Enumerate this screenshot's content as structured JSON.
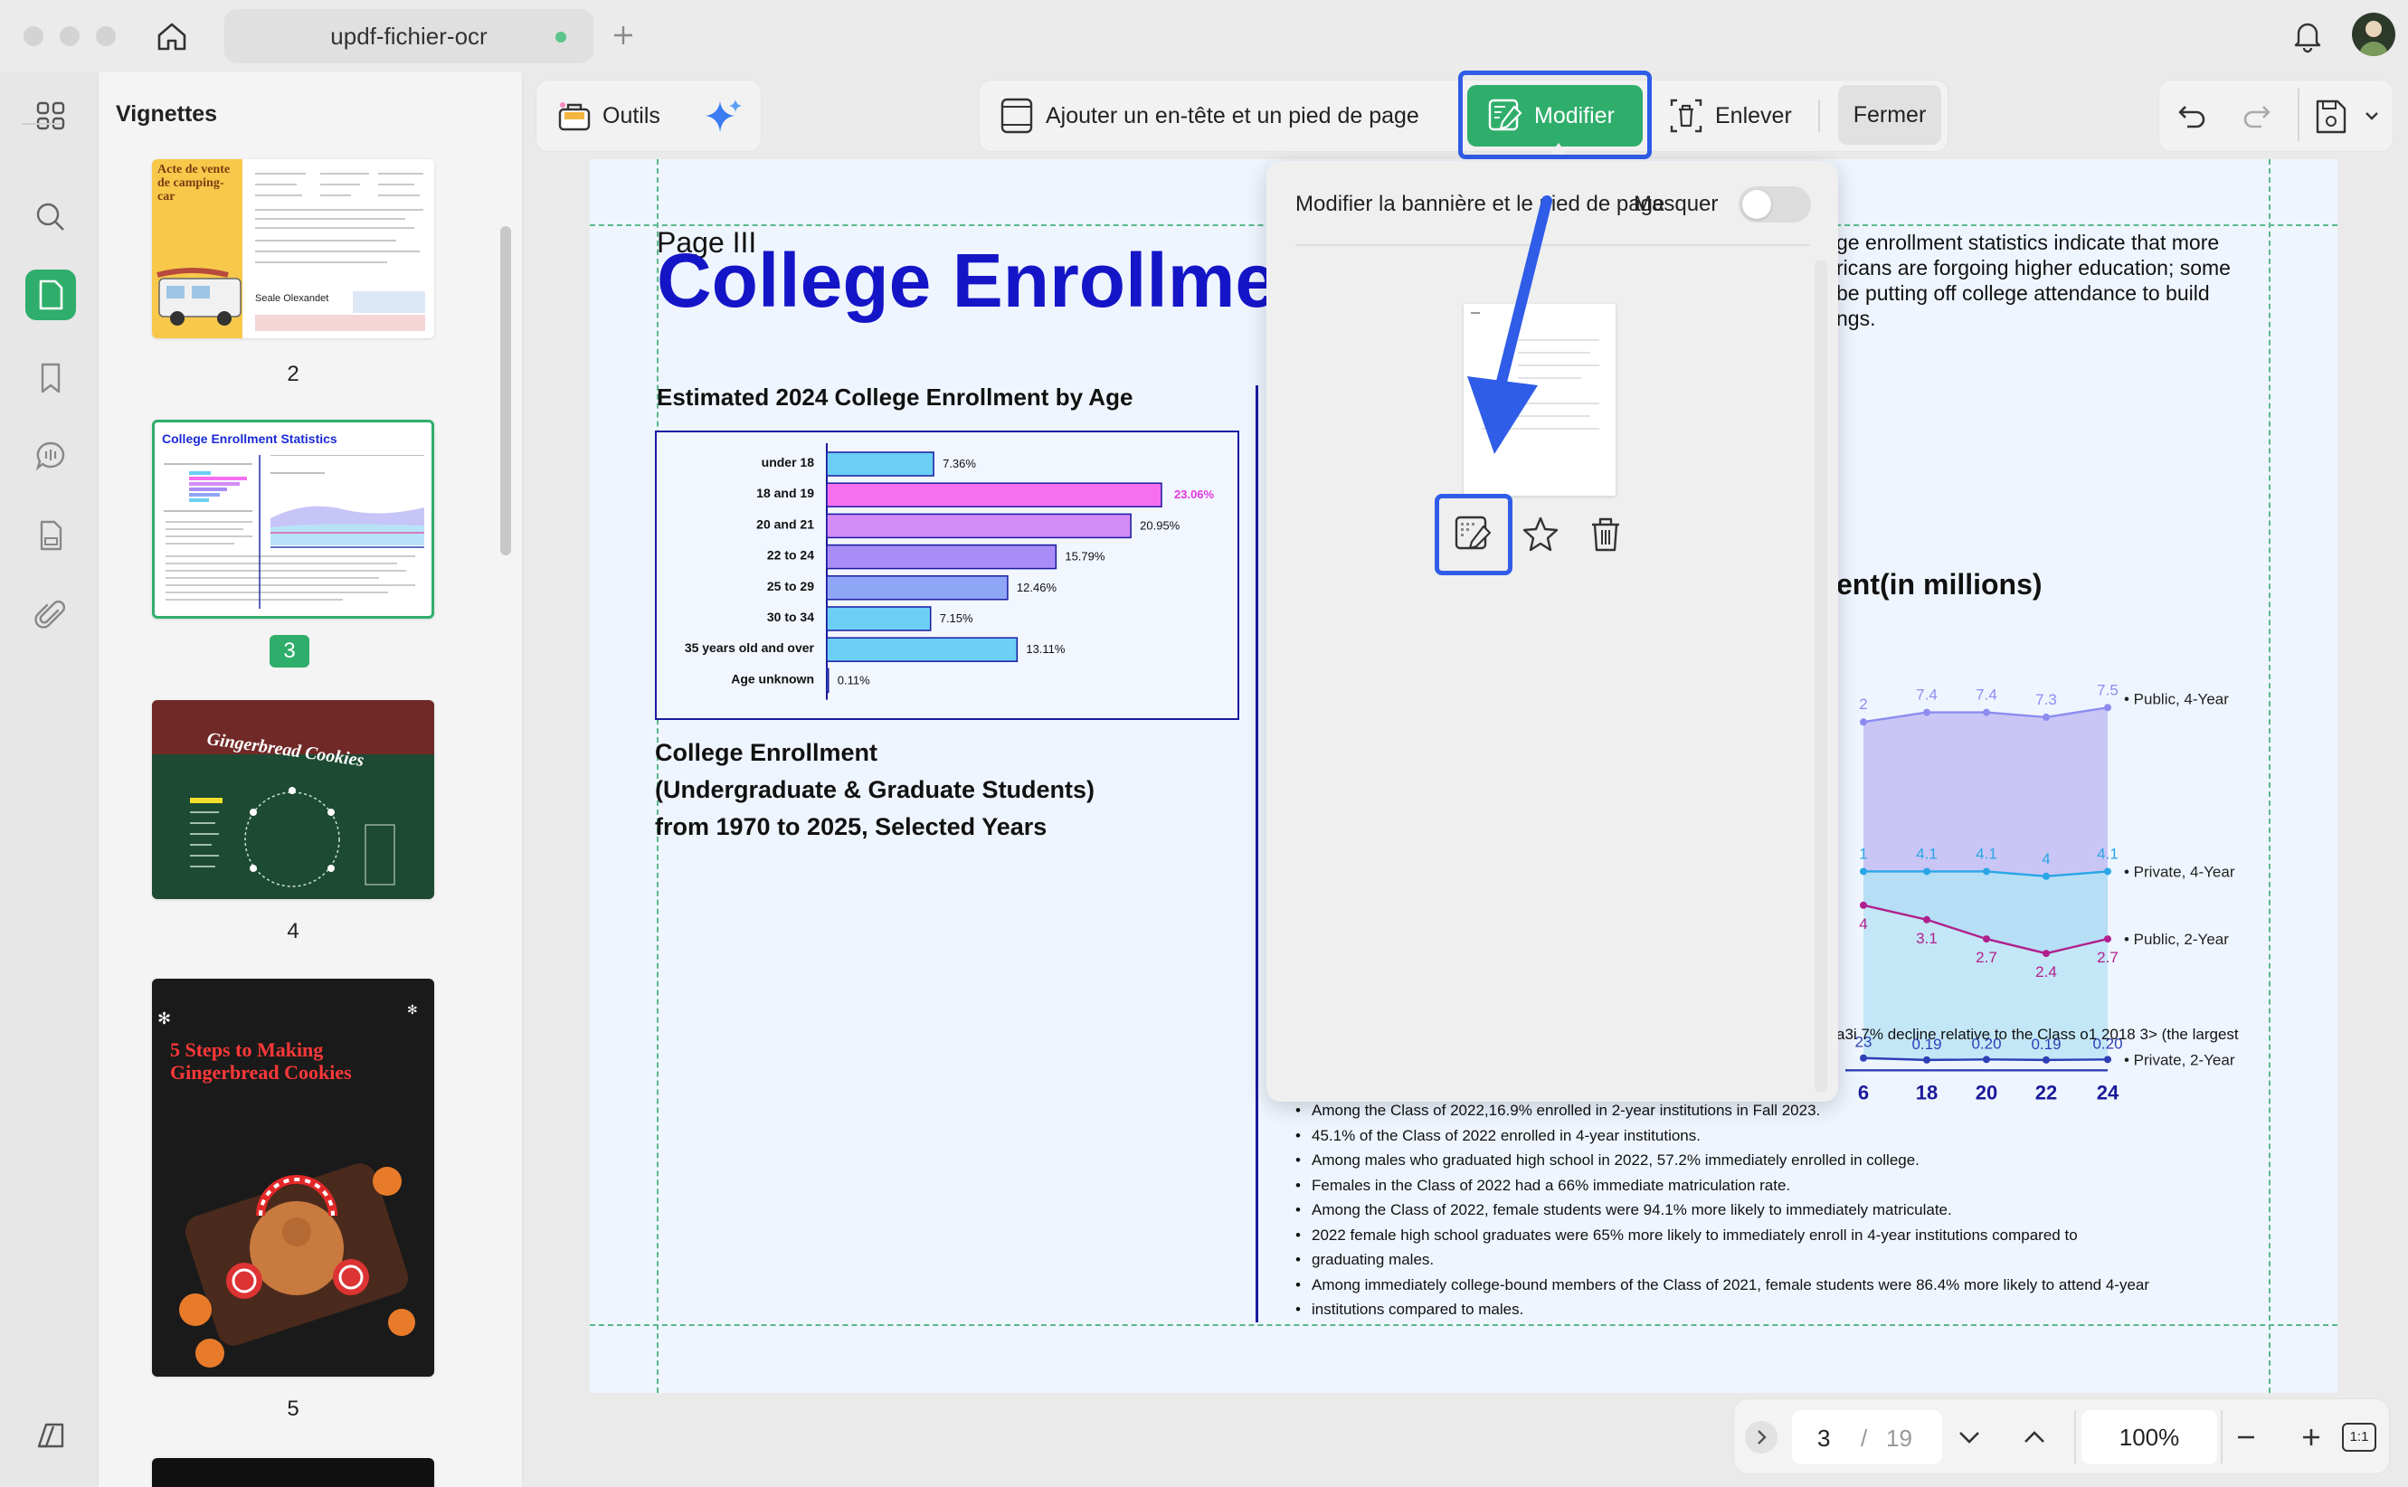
{
  "app": {
    "tab_title": "updf-fichier-ocr"
  },
  "sidebar": {
    "title": "Vignettes",
    "pages": [
      {
        "num": "2",
        "title": "Acte de vente de camping-car",
        "seller": "Seale Olexandet"
      },
      {
        "num": "3",
        "title": "College Enrollment Statistics"
      },
      {
        "num": "4",
        "title": "Gingerbread Cookies"
      },
      {
        "num": "5",
        "title": "5 Steps to Making Gingerbread Cookies"
      }
    ]
  },
  "toolbar": {
    "tools_label": "Outils",
    "header_footer_label": "Ajouter un en-tête et un pied de page",
    "modify_label": "Modifier",
    "remove_label": "Enlever",
    "close_label": "Fermer"
  },
  "popup": {
    "title": "Modifier la bannière et le pied de page",
    "hide_label": "Masquer"
  },
  "document": {
    "page_label": "Page III",
    "title": "College Enrollme",
    "right_text": [
      "ge enrollment statistics indicate that more",
      "ricans are forgoing higher education; some",
      "be putting off college attendance to build",
      "ngs."
    ],
    "bar_chart_title": "Estimated 2024 College Enrollment by Age",
    "enrollment_heading": [
      "College Enrollment",
      "(Undergraduate & Graduate Students)",
      "from 1970 to 2025, Selected Years"
    ],
    "right_chart_title": "ent(in millions)",
    "decline_text": "a3i 7% decline relative to the Class o1 2018 3> (the largest",
    "bullets": [
      "Among the Class of 2022,16.9% enrolled in 2-year institutions in Fall 2023.",
      "45.1% of the Class of 2022 enrolled in 4-year institutions.",
      "Among males who graduated high school in 2022, 57.2% immediately enrolled in college.",
      "Females in the Class of 2022 had a 66% immediate matriculation rate.",
      "Among the Class of 2022, female students were 94.1% more likely to immediately matriculate.",
      "2022 female high school graduates were 65% more likely to immediately enroll in 4-year institutions compared to",
      "graduating males.",
      "Among immediately college-bound members of the Class of 2021, female students were 86.4% more likely to attend 4-year",
      "institutions compared to males."
    ]
  },
  "chart_data": [
    {
      "type": "bar",
      "title": "Estimated 2024 College Enrollment by Age",
      "categories": [
        "under 18",
        "18 and 19",
        "20 and 21",
        "22 to 24",
        "25 to 29",
        "30 to 34",
        "35 years old and over",
        "Age unknown"
      ],
      "values": [
        7.36,
        23.06,
        20.95,
        15.79,
        12.46,
        7.15,
        13.11,
        0.11
      ],
      "value_labels": [
        "7.36%",
        "23.06%",
        "20.95%",
        "15.79%",
        "12.46%",
        "7.15%",
        "13.11%",
        "0.11%"
      ],
      "colors": [
        "#6ccff6",
        "#f56ff0",
        "#d38cf5",
        "#a98cf5",
        "#8fa6f7",
        "#6ccff6",
        "#6ccff6",
        "#6ccff6"
      ],
      "highlight_color": "#e03be0",
      "xlim": [
        0,
        25
      ]
    },
    {
      "type": "area",
      "title": "ent(in millions)",
      "x": [
        "6",
        "18",
        "20",
        "22",
        "24"
      ],
      "series": [
        {
          "name": "Public, 4-Year",
          "labels": [
            "2",
            "7.4",
            "7.4",
            "7.3",
            "7.5"
          ],
          "values": [
            7.2,
            7.4,
            7.4,
            7.3,
            7.5
          ],
          "color": "#8c8cf0"
        },
        {
          "name": "Private, 4-Year",
          "labels": [
            "1",
            "4.1",
            "4.1",
            "4",
            "4.1"
          ],
          "values": [
            4.1,
            4.1,
            4.1,
            4.0,
            4.1
          ],
          "color": "#29a5e6"
        },
        {
          "name": "Public, 2-Year",
          "labels": [
            "4",
            "3.1",
            "2.7",
            "2.4",
            "2.7"
          ],
          "values": [
            3.4,
            3.1,
            2.7,
            2.4,
            2.7
          ],
          "color": "#b0208c"
        },
        {
          "name": "Private, 2-Year",
          "labels": [
            "23",
            "0.19",
            "0.20",
            "0.19",
            "0.20"
          ],
          "values": [
            0.23,
            0.19,
            0.2,
            0.19,
            0.2
          ],
          "color": "#2d3fb5"
        }
      ]
    }
  ],
  "footer": {
    "current_page": "3",
    "separator": "/",
    "total_pages": "19",
    "zoom": "100%",
    "fit_label": "1:1"
  }
}
